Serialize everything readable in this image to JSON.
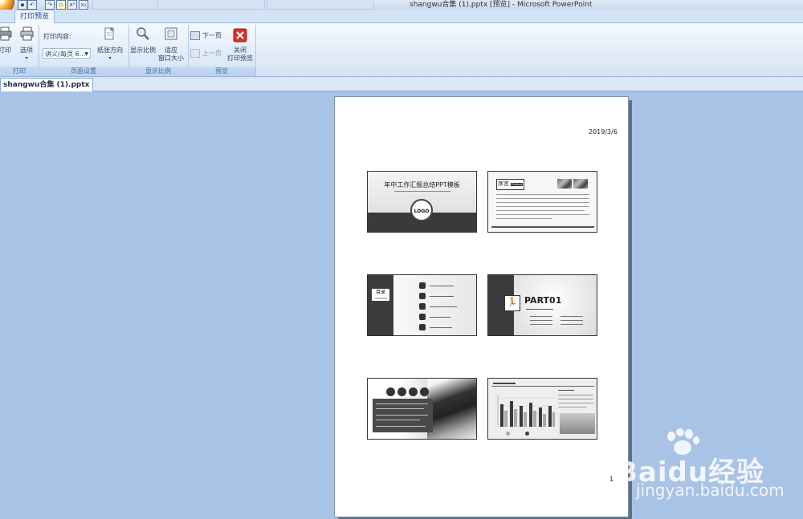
{
  "window": {
    "title": "shangwu合集 (1).pptx [预览] - Microsoft PowerPoint"
  },
  "ribbon": {
    "active_tab": "打印预览",
    "groups": {
      "print": {
        "label": "打印",
        "print_label": "打印",
        "options_label": "选项"
      },
      "page_setup": {
        "label": "页面设置",
        "print_content_label": "打印内容:",
        "print_content_value": "讲义(每页 6...",
        "orientation_label": "纸张方向"
      },
      "zoom": {
        "label": "显示比例",
        "zoom_label": "显示比例",
        "fit_label_1": "适应",
        "fit_label_2": "窗口大小"
      },
      "preview": {
        "label": "预览",
        "next_page_label": "下一页",
        "prev_page_label": "上一页",
        "close_label_1": "关闭",
        "close_label_2": "打印预览"
      }
    }
  },
  "document_tab": {
    "label": "shangwu合集 (1).pptx"
  },
  "page": {
    "date": "2019/3/6",
    "page_number": "1",
    "slides": {
      "s1": {
        "title": "年中工作汇报总结PPT模板",
        "logo": "LOGO"
      },
      "s2": {
        "heading": "序言",
        "heading_tag": "Preface"
      },
      "s3": {
        "heading": "目录",
        "heading_en": "CONTENTS"
      },
      "s4": {
        "part": "PART01"
      }
    }
  },
  "watermark": {
    "brand": "Baidu经验",
    "url": "jingyan.baidu.com"
  },
  "colors": {
    "ribbon_bg": "#e3edf9",
    "preview_bg": "#a9c3e6",
    "close_red": "#d9342b"
  },
  "icons": [
    "office-orb",
    "save-icon",
    "undo-icon",
    "print-icon",
    "options-icon",
    "orientation-icon",
    "zoom-icon",
    "fit-window-icon",
    "next-page-icon",
    "prev-page-icon",
    "close-icon"
  ]
}
